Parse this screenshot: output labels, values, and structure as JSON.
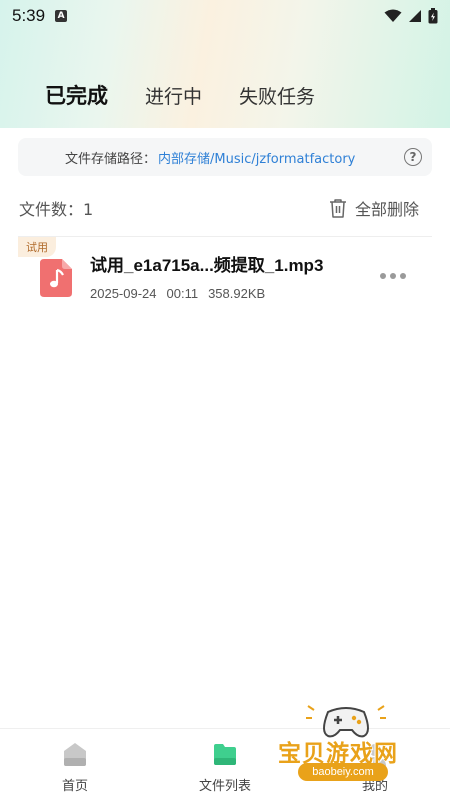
{
  "status_bar": {
    "time": "5:39",
    "app_icon": "A"
  },
  "tabs": [
    {
      "label": "已完成",
      "active": true
    },
    {
      "label": "进行中",
      "active": false
    },
    {
      "label": "失败任务",
      "active": false
    }
  ],
  "storage": {
    "label": "文件存储路径：",
    "path": "内部存储/Music/jzformatfactory",
    "help_icon": "?"
  },
  "file_count": {
    "label": "文件数：1"
  },
  "delete_all": {
    "label": "全部删除"
  },
  "files": [
    {
      "badge": "试用",
      "name": "试用_e1a715a...频提取_1.mp3",
      "date": "2025-09-24",
      "time": "00:11",
      "size": "358.92KB"
    }
  ],
  "bottom_nav": [
    {
      "label": "首页",
      "active": false
    },
    {
      "label": "文件列表",
      "active": true
    },
    {
      "label": "我的",
      "active": false
    }
  ],
  "watermark": {
    "text": "宝贝游戏网",
    "url": "baobeiy.com"
  },
  "colors": {
    "accent_green": "#3fcf8e",
    "link_blue": "#2f80d6",
    "badge_bg": "#fbeede",
    "music_red": "#f07070"
  }
}
